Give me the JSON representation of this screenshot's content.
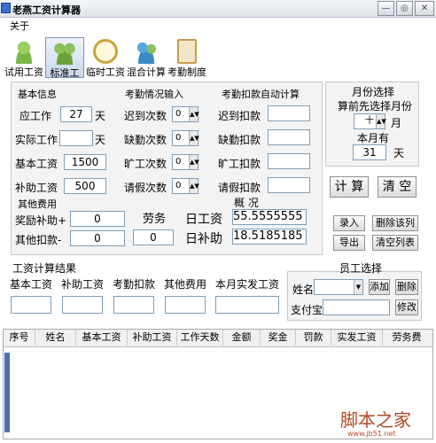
{
  "app": {
    "title": "老燕工资计算器",
    "min": "—",
    "restore": "◎",
    "close": "✕"
  },
  "menu": {
    "about": "关于"
  },
  "toolbar": [
    {
      "label": "试用工资",
      "icon": "person-icon",
      "color": "#7ab648"
    },
    {
      "label": "标准工资",
      "icon": "group-icon",
      "color": "#6aa23a"
    },
    {
      "label": "临时工资",
      "icon": "clock-icon",
      "color": "#c8a43a"
    },
    {
      "label": "混合计算",
      "icon": "people-icon",
      "color": "#3a8ac8"
    },
    {
      "label": "考勤制度",
      "icon": "clipboard-icon",
      "color": "#c89a4a"
    }
  ],
  "basic": {
    "title": "基本信息",
    "due_label": "应工作",
    "due_value": "27",
    "due_unit": "天",
    "actual_label": "实际工作",
    "actual_value": "",
    "actual_unit": "天",
    "base_label": "基本工资",
    "base_value": "1500",
    "subsidy_label": "补助工资",
    "subsidy_value": "500"
  },
  "attendance": {
    "title": "考勤情况输入",
    "rows": [
      {
        "label": "迟到次数",
        "value": "0"
      },
      {
        "label": "缺勤次数",
        "value": "0"
      },
      {
        "label": "旷工次数",
        "value": "0"
      },
      {
        "label": "请假次数",
        "value": "0"
      }
    ]
  },
  "deduct": {
    "title": "考勤扣款自动计算",
    "rows": [
      {
        "label": "迟到扣款",
        "value": ""
      },
      {
        "label": "缺勤扣款",
        "value": ""
      },
      {
        "label": "旷工扣款",
        "value": ""
      },
      {
        "label": "请假扣款",
        "value": ""
      }
    ]
  },
  "month": {
    "title": "月份选择",
    "hint": "算前先选择月份",
    "value": "十",
    "unit": "月",
    "days_label": "本月有",
    "days_value": "31",
    "days_unit": "天"
  },
  "other": {
    "title": "其他费用",
    "bonus_label": "奖励补助+",
    "bonus_value": "0",
    "deduct_label": "其他扣款-",
    "deduct_value": "0",
    "labor_label": "劳务",
    "labor_value": "0"
  },
  "overview": {
    "title": "概 况",
    "daily_label": "日工资",
    "daily_value": "55.5555555",
    "daily_sub_label": "日补助",
    "daily_sub_value": "18.5185185"
  },
  "buttons": {
    "calc": "计 算",
    "clear": "清 空",
    "enter": "录入",
    "delete_row": "删除该列",
    "export": "导出",
    "clear_list": "清空列表",
    "add": "添加",
    "delete": "删除",
    "edit": "修改"
  },
  "result": {
    "title": "工资计算结果",
    "cols": [
      "基本工资",
      "补助工资",
      "考勤扣款",
      "其他费用",
      "本月实发工资"
    ]
  },
  "employee": {
    "title": "员工选择",
    "name_label": "姓名",
    "alipay_label": "支付宝"
  },
  "grid": {
    "headers": [
      "序号",
      "姓名",
      "基本工资",
      "补助工资",
      "工作天数",
      "金额",
      "奖金",
      "罚款",
      "实发工资",
      "劳务费"
    ]
  },
  "watermark": {
    "main": "脚本之家",
    "url": "www.jb51.net"
  }
}
